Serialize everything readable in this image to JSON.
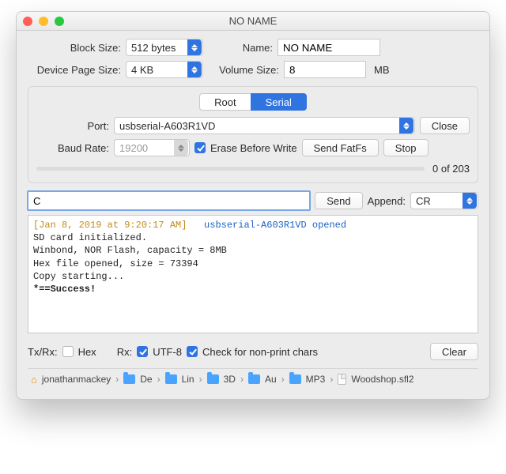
{
  "window": {
    "title": "NO NAME"
  },
  "traffic": {
    "close": "#ff5f57",
    "min": "#ffbd2e",
    "max": "#28c840"
  },
  "form": {
    "block_size_label": "Block Size:",
    "block_size_value": "512 bytes",
    "device_page_label": "Device Page Size:",
    "device_page_value": "4 KB",
    "name_label": "Name:",
    "name_value": "NO NAME",
    "volume_label": "Volume Size:",
    "volume_value": "8",
    "volume_unit": "MB"
  },
  "tabs": {
    "root": "Root",
    "serial": "Serial"
  },
  "serial": {
    "port_label": "Port:",
    "port_value": "usbserial-A603R1VD",
    "close_btn": "Close",
    "baud_label": "Baud Rate:",
    "baud_value": "19200",
    "erase_label": "Erase Before Write",
    "send_fatfs": "Send FatFs",
    "stop_btn": "Stop",
    "progress_text": "0 of 203"
  },
  "cmd": {
    "input_value": "C",
    "send_btn": "Send",
    "append_label": "Append:",
    "append_value": "CR"
  },
  "console": {
    "timestamp": "[Jan 8, 2019 at 9:20:17 AM]",
    "open_msg": "usbserial-A603R1VD opened",
    "line1": "SD card initialized.",
    "line2": "Winbond, NOR Flash, capacity = 8MB",
    "line3": "Hex file opened, size = 73394",
    "line4": "Copy starting...",
    "line5": "*==Success!"
  },
  "bottom": {
    "txrx": "Tx/Rx:",
    "hex": "Hex",
    "rx": "Rx:",
    "utf8": "UTF-8",
    "nonprint": "Check for non-print chars",
    "clear": "Clear"
  },
  "path": {
    "items": [
      "jonathanmackey",
      "De",
      "Lin",
      "3D",
      "Au",
      "MP3"
    ],
    "file": "Woodshop.sfl2"
  }
}
